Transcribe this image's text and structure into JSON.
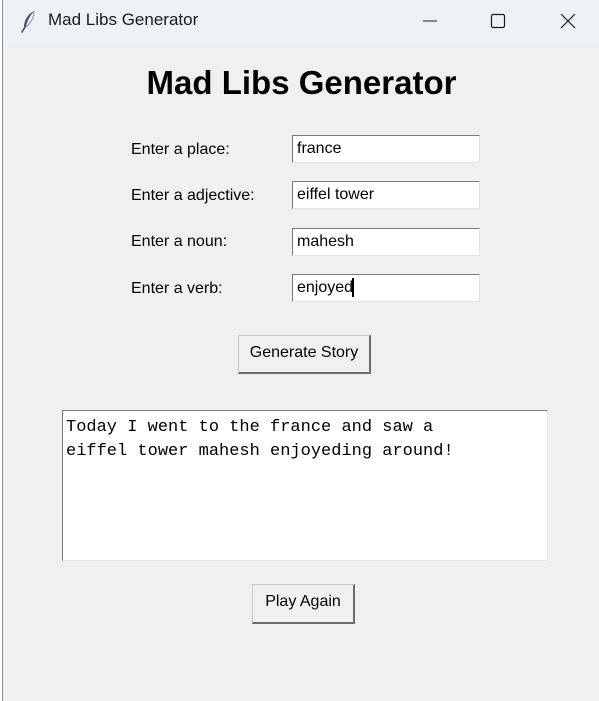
{
  "window": {
    "title": "Mad Libs Generator"
  },
  "heading": "Mad Libs Generator",
  "form": {
    "place_label": "Enter a place:",
    "place_value": "france",
    "adjective_label": "Enter a adjective:",
    "adjective_value": "eiffel tower",
    "noun_label": "Enter a noun:",
    "noun_value": "mahesh",
    "verb_label": "Enter a verb:",
    "verb_value": "enjoyed"
  },
  "generate_button_label": "Generate Story",
  "story_text": "Today I went to the france and saw a\neiffel tower mahesh enjoyeding around!",
  "play_again_button_label": "Play Again",
  "icons": {
    "app": "feather-icon",
    "minimize": "minimize-icon",
    "maximize": "maximize-icon",
    "close": "close-icon"
  }
}
